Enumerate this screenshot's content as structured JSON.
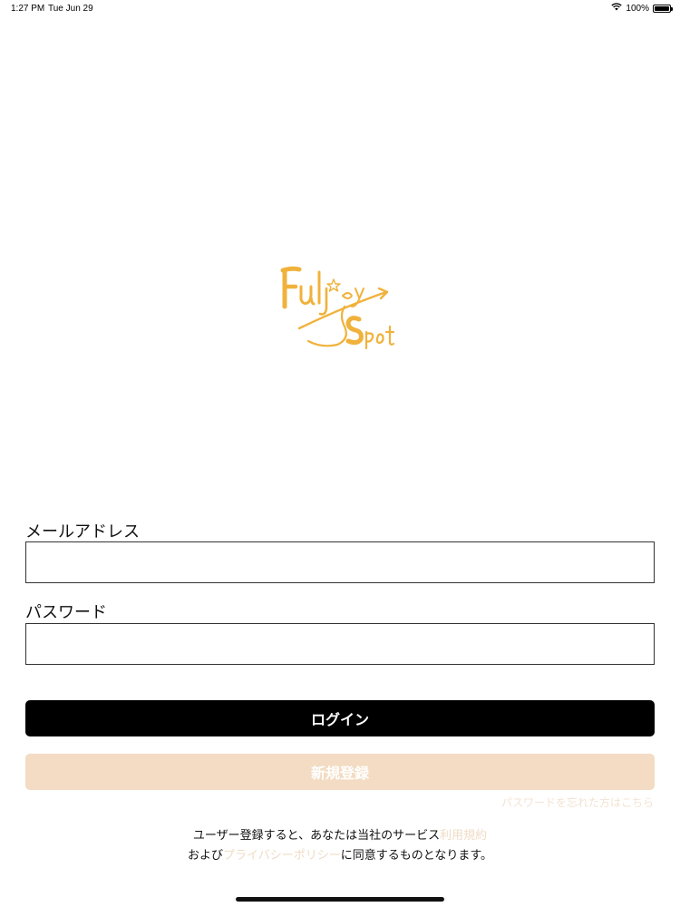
{
  "status_bar": {
    "time": "1:27 PM",
    "date": "Tue Jun 29",
    "battery": "100%",
    "battery_level": 1.0
  },
  "logo": {
    "line1": "Fuljoy",
    "line2": "Spot",
    "color": "#f0b23c"
  },
  "form": {
    "email_label": "メールアドレス",
    "email_value": "",
    "password_label": "パスワード",
    "password_value": ""
  },
  "buttons": {
    "login_label": "ログイン",
    "register_label": "新規登録"
  },
  "forgot_password_link": "パスワードを忘れた方はこちら",
  "terms": {
    "line1_prefix": "ユーザー登録すると、あなたは当社のサービス",
    "terms_link": "利用規約",
    "line2_prefix": "および",
    "privacy_link": "プライバシーポリシー",
    "line2_suffix": "に同意するものとなります。"
  },
  "colors": {
    "login_bg": "#000000",
    "register_bg": "#f3dcc3",
    "link_color": "#f0dcc5"
  }
}
